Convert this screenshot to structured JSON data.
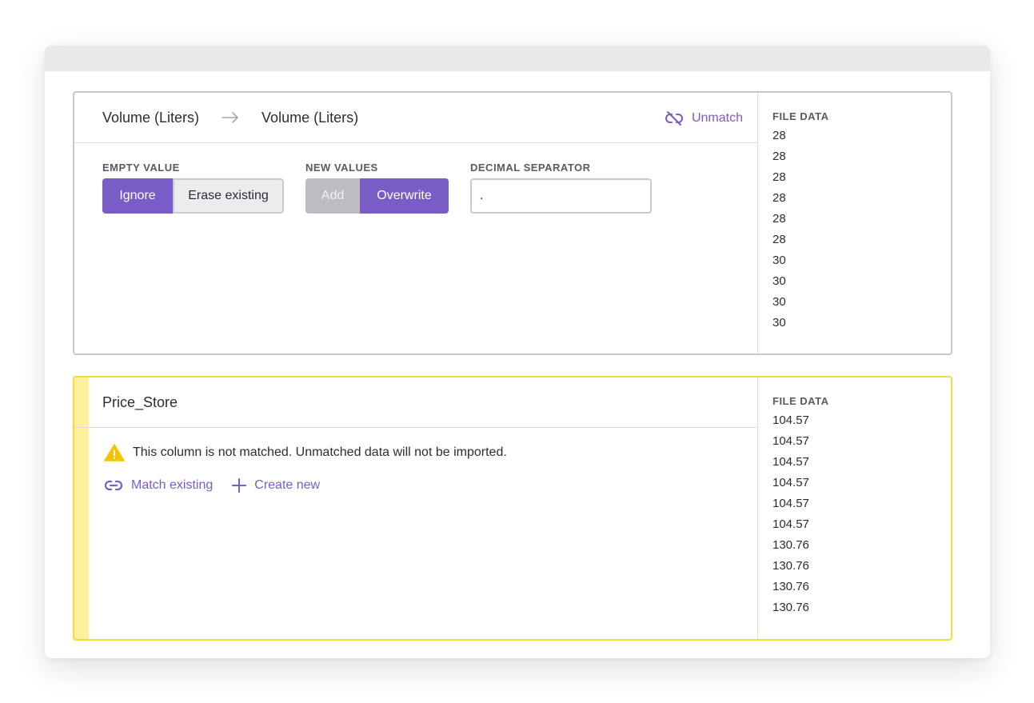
{
  "colors": {
    "accent": "#7a5cc6",
    "warning": "#f4dc3a",
    "warning_stripe": "#fff09c"
  },
  "matched": {
    "source_column": "Volume (Liters)",
    "target_column": "Volume (Liters)",
    "unmatch_label": "Unmatch",
    "empty_value": {
      "label": "EMPTY VALUE",
      "options": [
        "Ignore",
        "Erase existing"
      ],
      "selected": "Ignore"
    },
    "new_values": {
      "label": "NEW VALUES",
      "options": [
        "Add",
        "Overwrite"
      ],
      "selected": "Overwrite"
    },
    "decimal_separator": {
      "label": "DECIMAL SEPARATOR",
      "value": "."
    },
    "file_data": {
      "title": "FILE DATA",
      "values": [
        "28",
        "28",
        "28",
        "28",
        "28",
        "28",
        "30",
        "30",
        "30",
        "30"
      ]
    }
  },
  "unmatched": {
    "column": "Price_Store",
    "warning": "This column is not matched. Unmatched data will not be imported.",
    "match_existing": "Match existing",
    "create_new": "Create new",
    "file_data": {
      "title": "FILE DATA",
      "values": [
        "104.57",
        "104.57",
        "104.57",
        "104.57",
        "104.57",
        "104.57",
        "130.76",
        "130.76",
        "130.76",
        "130.76"
      ]
    }
  }
}
